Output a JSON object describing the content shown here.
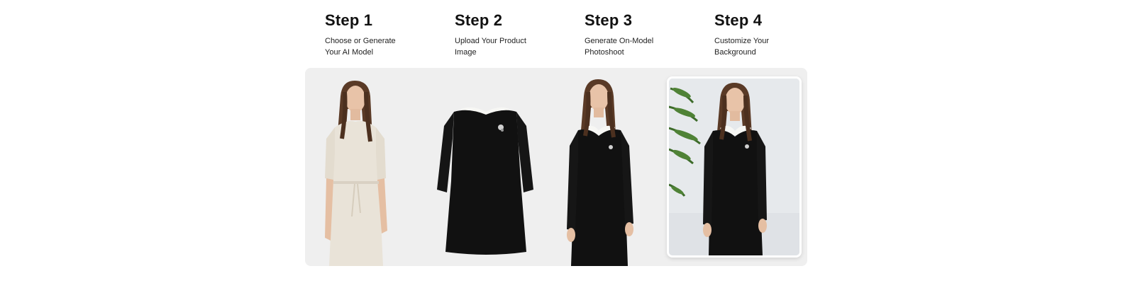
{
  "steps": [
    {
      "title": "Step 1",
      "line1": "Choose or Generate",
      "line2": "Your AI Model"
    },
    {
      "title": "Step 2",
      "line1": "Upload Your Product",
      "line2": "Image"
    },
    {
      "title": "Step 3",
      "line1": "Generate On-Model",
      "line2": "Photoshoot"
    },
    {
      "title": "Step 4",
      "line1": "Customize Your",
      "line2": "Background"
    }
  ],
  "colors": {
    "panel": "#efefef",
    "dress_black": "#111111",
    "dress_cream": "#e9e3d8",
    "collar_white": "#f7f7f4",
    "hair": "#5a3a26",
    "skin": "#e8c3a8",
    "plant": "#3d6b2a"
  },
  "icons": {
    "step1": "model-cream-dress-image",
    "step2": "black-dress-product-image",
    "step3": "model-black-dress-image",
    "step4": "model-styled-background-image"
  }
}
